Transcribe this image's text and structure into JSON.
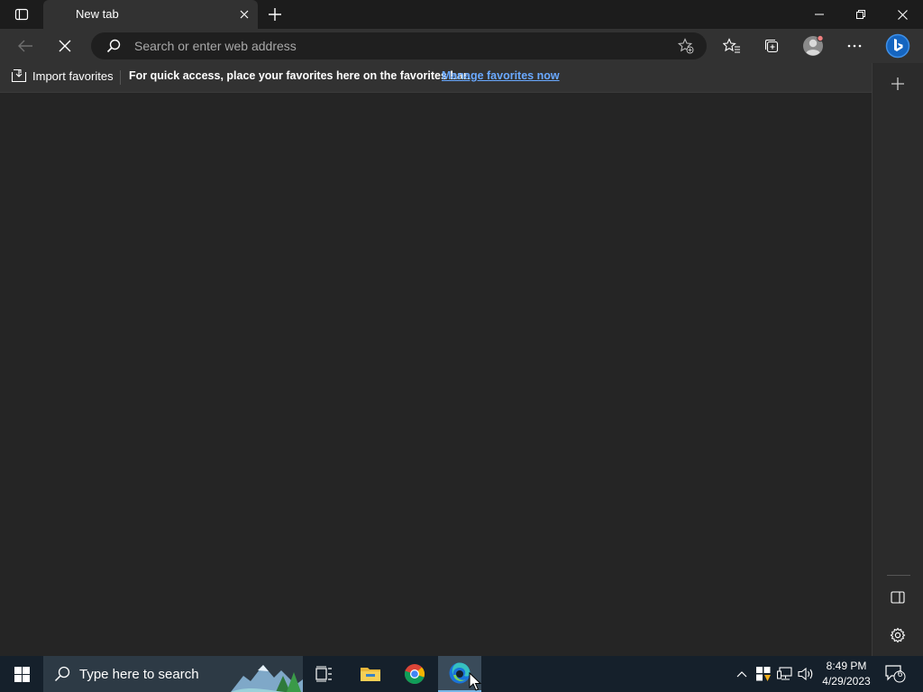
{
  "tab": {
    "title": "New tab"
  },
  "address_bar": {
    "placeholder": "Search or enter web address"
  },
  "favorites_bar": {
    "import_label": "Import favorites",
    "message": "For quick access, place your favorites here on the favorites bar.",
    "manage_link": "Manage favorites now"
  },
  "taskbar": {
    "search_placeholder": "Type here to search",
    "clock_time": "8:49 PM",
    "clock_date": "4/29/2023",
    "notification_count": "6"
  },
  "colors": {
    "accent_link": "#6aa9ff",
    "bing_blue": "#1e88e5",
    "taskbar_bg": "#15202b"
  }
}
